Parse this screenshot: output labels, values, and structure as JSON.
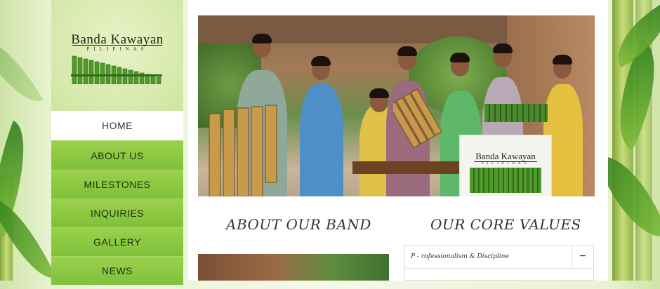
{
  "logo": {
    "title": "Banda Kawayan",
    "subtitle": "PILIPINAS"
  },
  "nav": {
    "items": [
      {
        "label": "HOME",
        "active": true
      },
      {
        "label": "ABOUT US",
        "active": false
      },
      {
        "label": "MILESTONES",
        "active": false
      },
      {
        "label": "INQUIRIES",
        "active": false
      },
      {
        "label": "GALLERY",
        "active": false
      },
      {
        "label": "NEWS",
        "active": false
      }
    ]
  },
  "hero": {
    "banner_title": "Banda Kawayan",
    "banner_subtitle": "PILIPINAS"
  },
  "sections": {
    "about_heading": "ABOUT OUR BAND",
    "values_heading": "OUR CORE VALUES"
  },
  "core_values": {
    "first_item": "P - rofessionalism & Discipline",
    "toggle_symbol": "−"
  },
  "colors": {
    "nav_green": "#8cc63f",
    "active_bg": "#ffffff",
    "heading_text": "#333333"
  }
}
